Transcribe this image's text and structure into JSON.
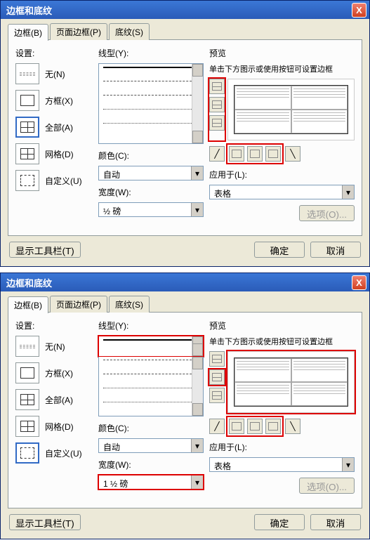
{
  "dialogs": [
    {
      "title": "边框和底纹",
      "tabs": [
        "边框(B)",
        "页面边框(P)",
        "底纹(S)"
      ],
      "activeTab": 0,
      "settings": {
        "label": "设置:",
        "items": [
          {
            "label": "无(N)",
            "icon": "none"
          },
          {
            "label": "方框(X)",
            "icon": "box"
          },
          {
            "label": "全部(A)",
            "icon": "all",
            "selected": true
          },
          {
            "label": "网格(D)",
            "icon": "grid"
          },
          {
            "label": "自定义(U)",
            "icon": "custom"
          }
        ]
      },
      "lineStyle": {
        "label": "线型(Y):",
        "highlight": false
      },
      "color": {
        "label": "颜色(C):",
        "value": "自动"
      },
      "width": {
        "label": "宽度(W):",
        "value": "½ 磅",
        "highlight": false
      },
      "preview": {
        "label": "预览",
        "hint": "单击下方图示或使用按钮可设置边框",
        "vbtnsHi": true,
        "hbtnsHi": true,
        "boxHi": false
      },
      "applyTo": {
        "label": "应用于(L):",
        "value": "表格"
      },
      "options": "选项(O)...",
      "toolbar": "显示工具栏(T)",
      "ok": "确定",
      "cancel": "取消"
    },
    {
      "title": "边框和底纹",
      "tabs": [
        "边框(B)",
        "页面边框(P)",
        "底纹(S)"
      ],
      "activeTab": 0,
      "settings": {
        "label": "设置:",
        "items": [
          {
            "label": "无(N)",
            "icon": "none"
          },
          {
            "label": "方框(X)",
            "icon": "box"
          },
          {
            "label": "全部(A)",
            "icon": "all"
          },
          {
            "label": "网格(D)",
            "icon": "grid"
          },
          {
            "label": "自定义(U)",
            "icon": "custom",
            "selected": true
          }
        ]
      },
      "lineStyle": {
        "label": "线型(Y):",
        "highlight": true
      },
      "color": {
        "label": "颜色(C):",
        "value": "自动"
      },
      "width": {
        "label": "宽度(W):",
        "value": "1 ½ 磅",
        "highlight": true
      },
      "preview": {
        "label": "预览",
        "hint": "单击下方图示或使用按钮可设置边框",
        "vbtnsHi": false,
        "hbtnsHi": true,
        "midHi": true,
        "boxHi": true
      },
      "applyTo": {
        "label": "应用于(L):",
        "value": "表格"
      },
      "options": "选项(O)...",
      "toolbar": "显示工具栏(T)",
      "ok": "确定",
      "cancel": "取消"
    }
  ]
}
